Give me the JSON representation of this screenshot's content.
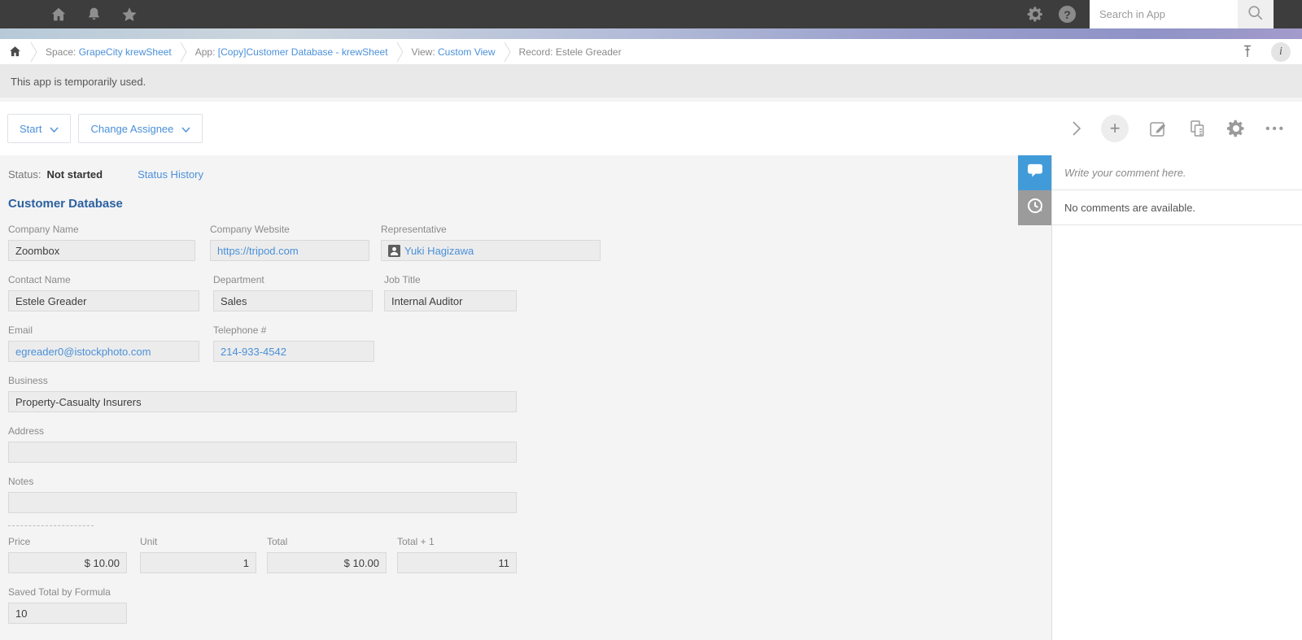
{
  "topbar": {
    "search": {
      "placeholder": "Search in App"
    }
  },
  "breadcrumb": {
    "space_prefix": "Space: ",
    "space_link": "GrapeCity krewSheet",
    "app_prefix": "App: ",
    "app_link": "[Copy]Customer Database - krewSheet",
    "view_prefix": "View: ",
    "view_link": "Custom View",
    "record_prefix": "Record: ",
    "record_name": "Estele Greader"
  },
  "banner": {
    "message": "This app is temporarily used."
  },
  "toolbar": {
    "start_label": "Start",
    "change_assignee_label": "Change Assignee"
  },
  "status": {
    "label": "Status:",
    "value": "Not started",
    "history_label": "Status History"
  },
  "record": {
    "title": "Customer Database",
    "fields": {
      "company_name": {
        "label": "Company Name",
        "value": "Zoombox"
      },
      "company_website": {
        "label": "Company Website",
        "value": "https://tripod.com"
      },
      "representative": {
        "label": "Representative",
        "value": "Yuki Hagizawa"
      },
      "contact_name": {
        "label": "Contact Name",
        "value": "Estele Greader"
      },
      "department": {
        "label": "Department",
        "value": "Sales"
      },
      "job_title": {
        "label": "Job Title",
        "value": "Internal Auditor"
      },
      "email": {
        "label": "Email",
        "value": "egreader0@istockphoto.com"
      },
      "telephone": {
        "label": "Telephone #",
        "value": "214-933-4542"
      },
      "business": {
        "label": "Business",
        "value": "Property-Casualty Insurers"
      },
      "address": {
        "label": "Address",
        "value": ""
      },
      "notes": {
        "label": "Notes",
        "value": ""
      },
      "price": {
        "label": "Price",
        "value": "$ 10.00"
      },
      "unit": {
        "label": "Unit",
        "value": "1"
      },
      "total": {
        "label": "Total",
        "value": "$ 10.00"
      },
      "total_plus_one": {
        "label": "Total + 1",
        "value": "11"
      },
      "saved_total": {
        "label": "Saved Total by Formula",
        "value": "10"
      }
    }
  },
  "comments": {
    "placeholder": "Write your comment here.",
    "empty_message": "No comments are available."
  },
  "colors": {
    "link_blue": "#4a90d9",
    "title_blue": "#2c61a0",
    "comment_tab_blue": "#419bd9",
    "history_tab_gray": "#9b9b9b",
    "topbar_dark": "#3d3d3d"
  }
}
